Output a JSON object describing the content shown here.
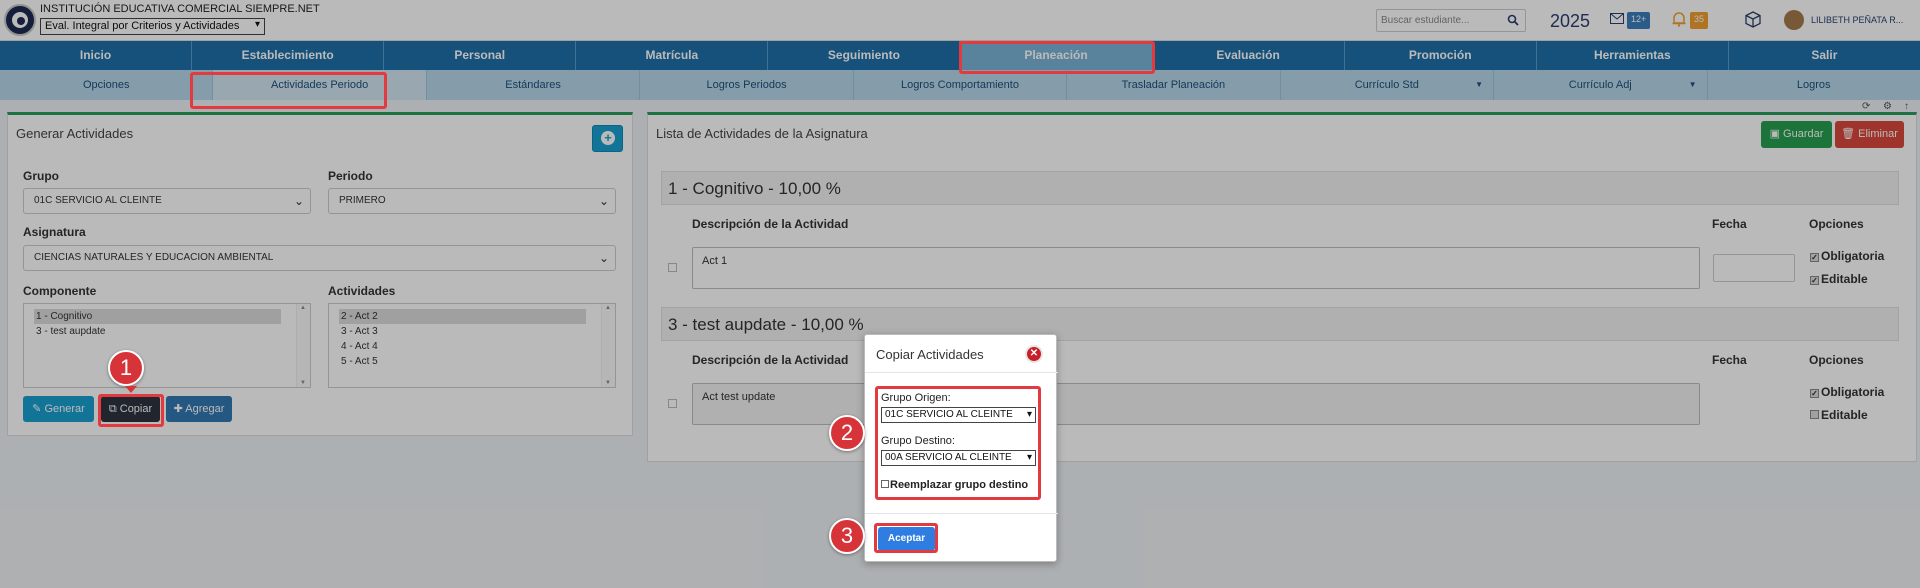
{
  "header": {
    "institution": "INSTITUCIÓN EDUCATIVA COMERCIAL SIEMPRE.NET",
    "mode_select": "Eval. Integral por Criterios y Actividades",
    "search_placeholder": "Buscar estudiante...",
    "year": "2025",
    "messages_badge": "12+",
    "notifications_badge": "35",
    "user_name": "LILIBETH PEÑATA R..."
  },
  "main_menu": [
    "Inicio",
    "Establecimiento",
    "Personal",
    "Matrícula",
    "Seguimiento",
    "Planeación",
    "Evaluación",
    "Promoción",
    "Herramientas",
    "Salir"
  ],
  "sub_menu": [
    "Opciones",
    "Actividades Periodo",
    "Estándares",
    "Logros Periodos",
    "Logros Comportamiento",
    "Trasladar Planeación",
    "Currículo Std",
    "Currículo Adj",
    "Logros"
  ],
  "left_panel": {
    "title": "Generar Actividades",
    "grupo_label": "Grupo",
    "grupo_value": "01C SERVICIO AL CLEINTE",
    "periodo_label": "Periodo",
    "periodo_value": "PRIMERO",
    "asignatura_label": "Asignatura",
    "asignatura_value": "CIENCIAS NATURALES Y EDUCACION AMBIENTAL",
    "componente_label": "Componente",
    "componentes": [
      "1 - Cognitivo",
      "3 - test aupdate"
    ],
    "actividades_label": "Actividades",
    "actividades": [
      "2 - Act 2",
      "3 - Act 3",
      "4 - Act 4",
      "5 - Act 5"
    ],
    "btn_generar": "Generar",
    "btn_copiar": "Copiar",
    "btn_agregar": "Agregar"
  },
  "right_panel": {
    "title": "Lista de Actividades de la Asignatura",
    "btn_guardar": "Guardar",
    "btn_eliminar": "Eliminar",
    "col_desc": "Descripción de la Actividad",
    "col_fecha": "Fecha",
    "col_opciones": "Opciones",
    "opt_obligatoria": "Obligatoria",
    "opt_editable": "Editable",
    "groups": [
      {
        "title": "1 - Cognitivo - 10,00 %",
        "activity": "Act 1"
      },
      {
        "title": "3 - test aupdate - 10,00 %",
        "activity": "Act test update"
      }
    ]
  },
  "modal": {
    "title": "Copiar Actividades",
    "origen_label": "Grupo Origen:",
    "origen_value": "01C SERVICIO AL CLEINTE",
    "destino_label": "Grupo Destino:",
    "destino_value": "00A SERVICIO AL CLEINTE",
    "replace_label": "Reemplazar grupo destino",
    "accept": "Aceptar"
  },
  "annotations": [
    "1",
    "2",
    "3"
  ],
  "colors": {
    "nav_primary": "#1d6fa8",
    "nav_secondary": "#b7d7ea",
    "highlight": "#e23a3e",
    "accept": "#2f7de1"
  }
}
